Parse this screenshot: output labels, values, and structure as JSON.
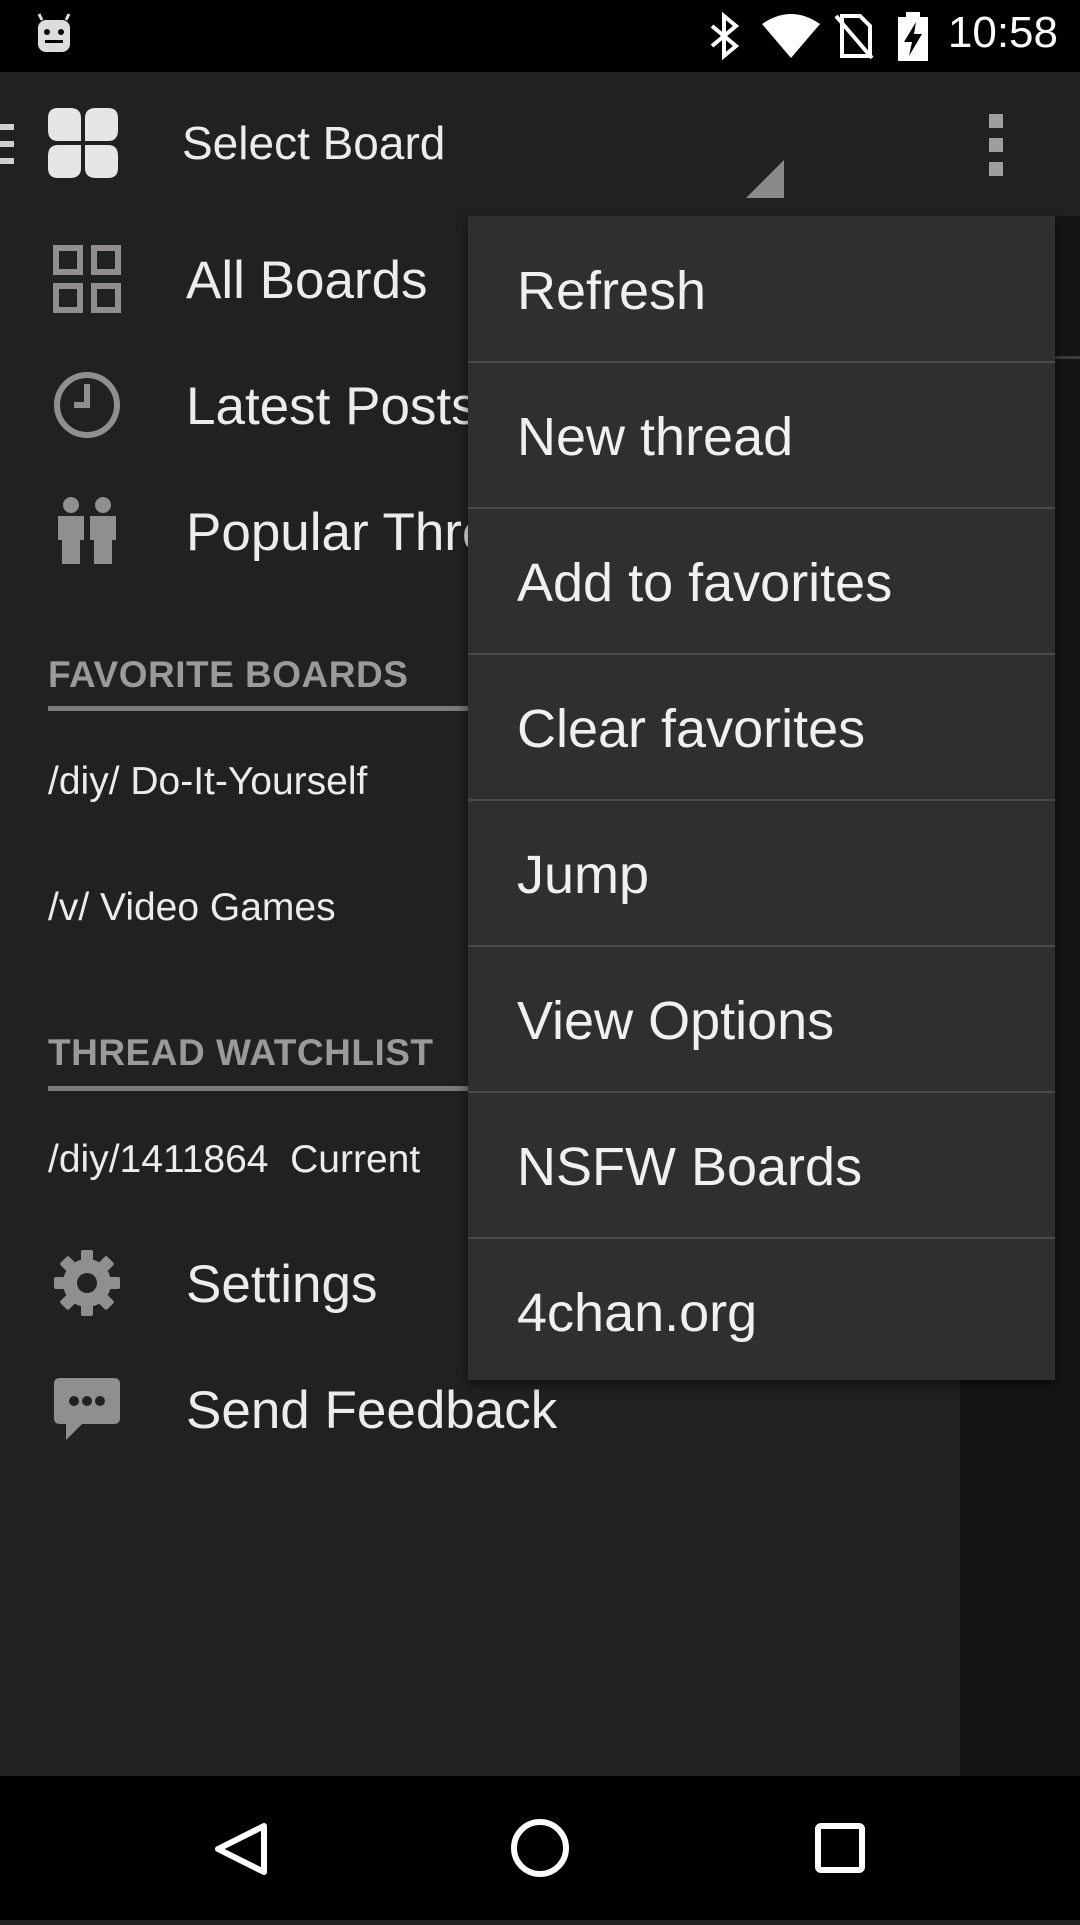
{
  "status_bar": {
    "time": "10:58",
    "icons": [
      "android-icon",
      "bluetooth-icon",
      "wifi-icon",
      "no-sim-icon",
      "battery-charging-icon"
    ]
  },
  "action_bar": {
    "title": "Select Board",
    "icons": [
      "hamburger-icon",
      "clover-logo-icon",
      "spinner-arrow-icon",
      "overflow-menu-icon"
    ]
  },
  "drawer": {
    "nav_items": [
      {
        "label": "All Boards",
        "icon": "grid-icon"
      },
      {
        "label": "Latest Posts",
        "icon": "clock-icon"
      },
      {
        "label": "Popular Threads",
        "icon": "people-icon"
      }
    ],
    "favorites_header": "FAVORITE BOARDS",
    "favorites": [
      "/diy/ Do-It-Yourself",
      "/v/ Video Games"
    ],
    "watchlist_header": "THREAD WATCHLIST",
    "watchlist": [
      "/diy/1411864  Current"
    ],
    "footer_items": [
      {
        "label": "Settings",
        "icon": "gear-icon"
      },
      {
        "label": "Send Feedback",
        "icon": "chat-bubble-icon"
      }
    ]
  },
  "popup_menu": {
    "items": [
      "Refresh",
      "New thread",
      "Add to favorites",
      "Clear favorites",
      "Jump",
      "View Options",
      "NSFW Boards",
      "4chan.org"
    ]
  },
  "nav_bar": {
    "icons": [
      "back-icon",
      "home-icon",
      "recents-icon"
    ]
  }
}
